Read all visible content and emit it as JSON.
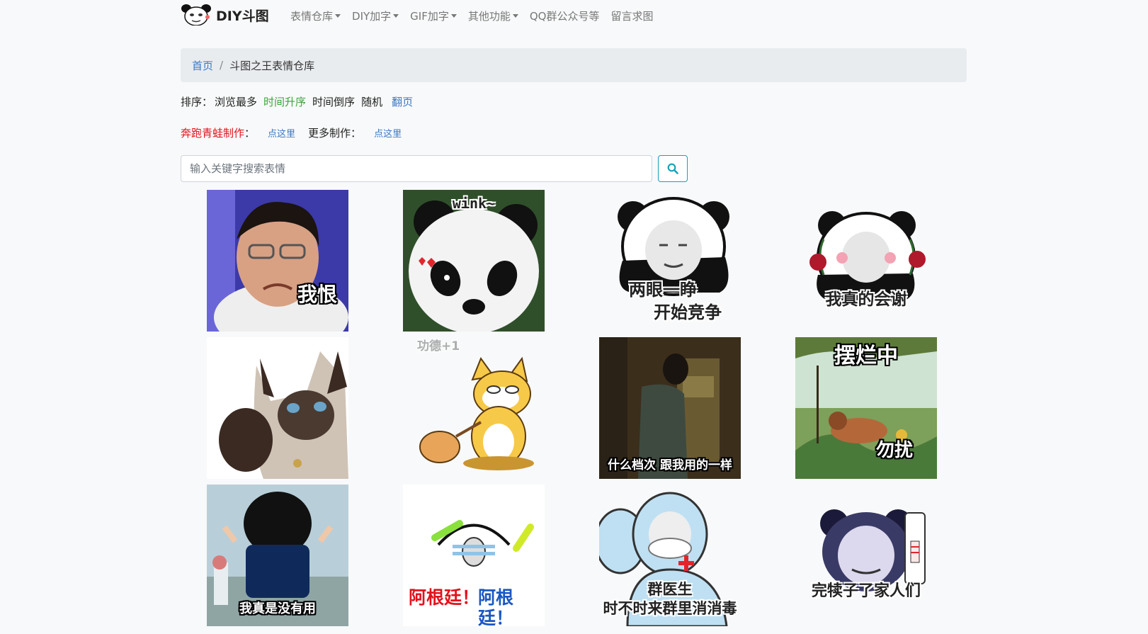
{
  "brand": {
    "name": "DIY斗图"
  },
  "nav": [
    {
      "label": "表情仓库",
      "dropdown": true
    },
    {
      "label": "DIY加字",
      "dropdown": true
    },
    {
      "label": "GIF加字",
      "dropdown": true
    },
    {
      "label": "其他功能",
      "dropdown": true
    },
    {
      "label": "QQ群公众号等",
      "dropdown": false
    },
    {
      "label": "留言求图",
      "dropdown": false
    }
  ],
  "breadcrumb": {
    "home": "首页",
    "separator": "/",
    "current": "斗图之王表情仓库"
  },
  "sort": {
    "label": "排序：",
    "items": [
      "浏览最多",
      "时间升序",
      "时间倒序",
      "随机"
    ],
    "active": "时间升序",
    "page_link": "翻页"
  },
  "make": {
    "frog_label": "奔跑青蛙制作",
    "colon": "：",
    "frog_link": "点这里",
    "more_label": "更多制作：",
    "more_link": "点这里"
  },
  "search": {
    "placeholder": "输入关键字搜索表情",
    "icon": "search-icon"
  },
  "memes": [
    {
      "caption": "我恨"
    },
    {
      "caption": "wink~"
    },
    {
      "caption_line1": "两眼一睁",
      "caption_line2": "开始竞争"
    },
    {
      "caption": "我真的会谢"
    },
    {
      "caption": ""
    },
    {
      "caption": "功德+1"
    },
    {
      "caption": "什么档次 跟我用的一样"
    },
    {
      "caption_top": "摆烂中",
      "caption_bottom": "勿扰"
    },
    {
      "caption": "我真是没有用"
    },
    {
      "caption_a": "阿根廷！",
      "caption_b": "阿根廷！"
    },
    {
      "caption_line1": "群医生",
      "caption_line2": "时不时来群里消消毒"
    },
    {
      "caption": "完犊子了家人们"
    }
  ],
  "colors": {
    "link": "#3a78c3",
    "active": "#3aa53a",
    "red": "#e3131c",
    "search_border": "#17a2b8"
  }
}
